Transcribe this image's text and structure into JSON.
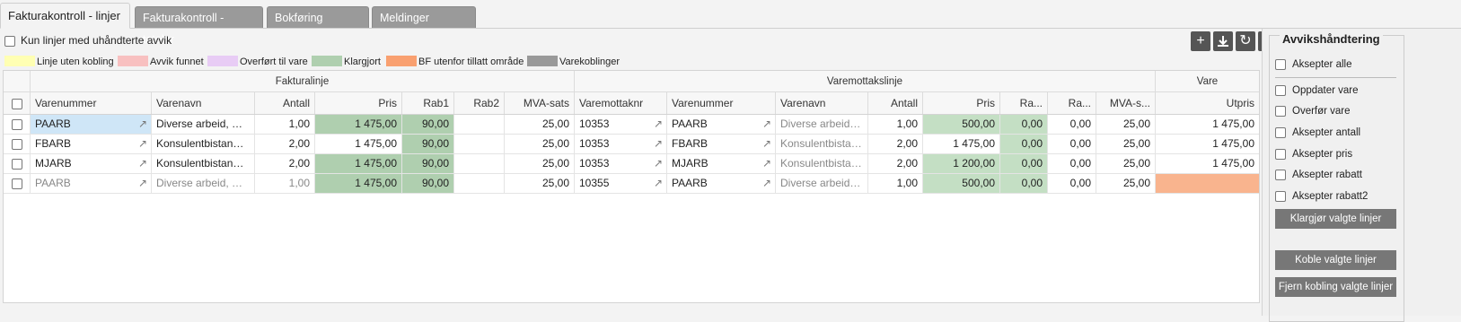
{
  "tabs": [
    {
      "label": "Fakturakontroll - linjer",
      "active": true
    },
    {
      "label": "Fakturakontroll - totaler",
      "active": false
    },
    {
      "label": "Bokføring",
      "active": false
    },
    {
      "label": "Meldinger",
      "active": false
    }
  ],
  "filter": {
    "label": "Kun linjer med uhåndterte avvik",
    "checked": false
  },
  "toolbar": [
    {
      "icon": "plus-icon"
    },
    {
      "icon": "download-icon"
    },
    {
      "icon": "refresh-icon"
    },
    {
      "icon": "arrow-right-icon"
    },
    {
      "icon": "menu-icon"
    }
  ],
  "legend": [
    {
      "label": "Linje uten kobling",
      "color": "#ffffb3"
    },
    {
      "label": "Avvik funnet",
      "color": "#f8c0c0"
    },
    {
      "label": "Overført til vare",
      "color": "#e8ccf5"
    },
    {
      "label": "Klargjort",
      "color": "#afcfaf"
    },
    {
      "label": "BF utenfor tillatt område",
      "color": "#f9a070"
    },
    {
      "label": "Varekoblinger",
      "color": "#999999"
    }
  ],
  "grid": {
    "groups": [
      "Fakturalinje",
      "Varemottakslinje",
      "Vare"
    ],
    "columns": [
      "Varenummer",
      "Varenavn",
      "Antall",
      "Pris",
      "Rab1",
      "Rab2",
      "MVA-sats",
      "Varemottaknr",
      "Varenummer",
      "Varenavn",
      "Antall",
      "Pris",
      "Ra...",
      "Ra...",
      "MVA-s...",
      "Utpris"
    ],
    "rows": [
      {
        "cells": [
          "PAARB",
          "Diverse arbeid, Per...",
          "1,00",
          "1 475,00",
          "90,00",
          "",
          "25,00",
          "10353",
          "PAARB",
          "Diverse arbeid, ...",
          "1,00",
          "500,00",
          "0,00",
          "0,00",
          "25,00",
          "1 475,00"
        ]
      },
      {
        "cells": [
          "FBARB",
          "Konsulentbistand, ...",
          "2,00",
          "1 475,00",
          "90,00",
          "",
          "25,00",
          "10353",
          "FBARB",
          "Konsulentbistan...",
          "2,00",
          "1 475,00",
          "0,00",
          "0,00",
          "25,00",
          "1 475,00"
        ]
      },
      {
        "cells": [
          "MJARB",
          "Konsulentbistand, ...",
          "2,00",
          "1 475,00",
          "90,00",
          "",
          "25,00",
          "10353",
          "MJARB",
          "Konsulentbistan...",
          "2,00",
          "1 200,00",
          "0,00",
          "0,00",
          "25,00",
          "1 475,00"
        ]
      },
      {
        "cells": [
          "PAARB",
          "Diverse arbeid, Per...",
          "1,00",
          "1 475,00",
          "90,00",
          "",
          "25,00",
          "10355",
          "PAARB",
          "Diverse arbeid, ...",
          "1,00",
          "500,00",
          "0,00",
          "0,00",
          "25,00",
          ""
        ]
      }
    ]
  },
  "panel": {
    "title": "Avvikshåndtering",
    "accept_all": "Aksepter alle",
    "options": [
      "Oppdater vare",
      "Overfør vare",
      "Aksepter antall",
      "Aksepter pris",
      "Aksepter rabatt",
      "Aksepter rabatt2"
    ],
    "buttons": [
      "Klargjør valgte linjer",
      "Koble valgte linjer",
      "Fjern kobling valgte linjer"
    ]
  }
}
